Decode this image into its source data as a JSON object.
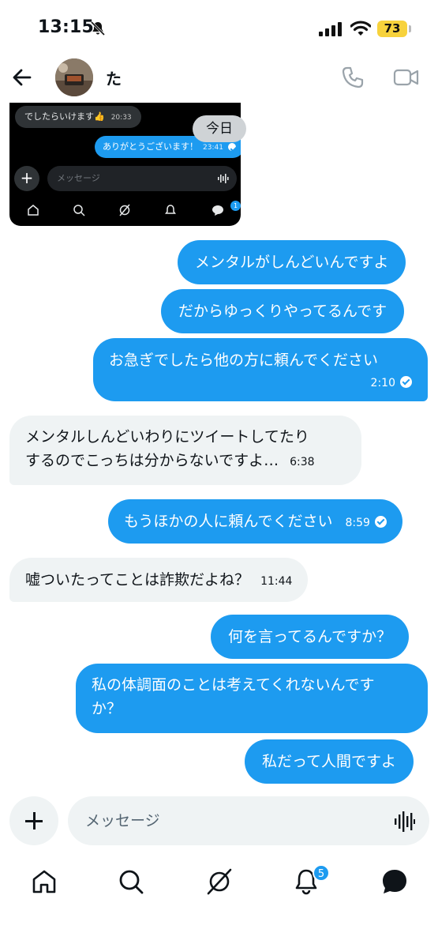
{
  "status_bar": {
    "time": "13:15",
    "battery": "73",
    "icons": [
      "bell-slash-icon",
      "signal-icon",
      "wifi-icon",
      "battery-icon"
    ]
  },
  "header": {
    "name": "た",
    "icons": [
      "back-arrow-icon",
      "phone-icon",
      "video-camera-icon"
    ]
  },
  "shared_screenshot": {
    "received_text": "でしたらいけます👍",
    "received_time": "20:33",
    "sent_text": "ありがとうございます！",
    "sent_time": "23:41",
    "composer_placeholder": "メッセージ",
    "badge": "1"
  },
  "date_separator": "今日",
  "messages": [
    {
      "dir": "out",
      "text": "メンタルがしんどいんですよ"
    },
    {
      "dir": "out",
      "text": "だからゆっくりやってるんです"
    },
    {
      "dir": "out",
      "text": "お急ぎでしたら他の方に頼んでください",
      "time": "2:10"
    },
    {
      "dir": "in",
      "line1": "メンタルしんどいわりにツイートしてたり",
      "line2": "するのでこっちは分からないですよ…",
      "time": "6:38"
    },
    {
      "dir": "out",
      "text": "もうほかの人に頼んでください",
      "time": "8:59"
    },
    {
      "dir": "in",
      "text": "嘘ついたってことは詐欺だよね？",
      "time": "11:44"
    },
    {
      "dir": "out",
      "text": "何を言ってるんですか？"
    },
    {
      "dir": "out",
      "line1": "私の体調面のことは考えてくれないんです",
      "line2": "か？"
    },
    {
      "dir": "out",
      "text": "私だって人間ですよ"
    }
  ],
  "composer": {
    "placeholder": "メッセージ"
  },
  "bottom_nav": {
    "items": [
      "home-icon",
      "search-icon",
      "grok-icon",
      "notifications-icon",
      "messages-icon"
    ],
    "notifications_badge": "5"
  },
  "colors": {
    "accent": "#1d9bf0",
    "incoming_bubble": "#eff3f4",
    "battery": "#f7d23c"
  }
}
